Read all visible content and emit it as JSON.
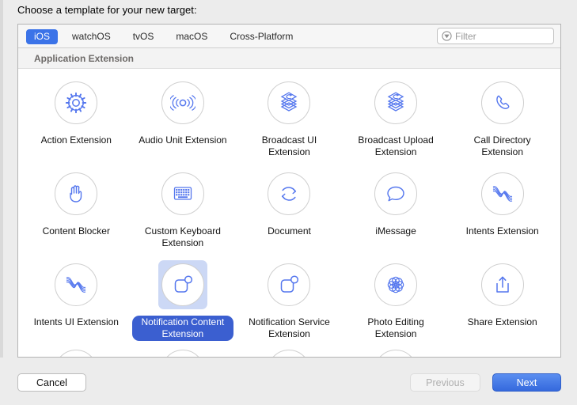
{
  "dialog": {
    "title": "Choose a template for your new target:"
  },
  "toolbar": {
    "tabs": [
      {
        "label": "iOS",
        "selected": true
      },
      {
        "label": "watchOS",
        "selected": false
      },
      {
        "label": "tvOS",
        "selected": false
      },
      {
        "label": "macOS",
        "selected": false
      },
      {
        "label": "Cross-Platform",
        "selected": false
      }
    ],
    "filter": {
      "placeholder": "Filter",
      "value": "",
      "icon": "filter-icon"
    },
    "selected_tab_color": "#3b73e8"
  },
  "section": {
    "header": "Application Extension"
  },
  "templates": [
    {
      "label": "Action Extension",
      "icon": "gear-icon",
      "selected": false
    },
    {
      "label": "Audio Unit Extension",
      "icon": "audio-waves-icon",
      "selected": false
    },
    {
      "label": "Broadcast UI Extension",
      "icon": "broadcast-layers-icon",
      "selected": false
    },
    {
      "label": "Broadcast Upload Extension",
      "icon": "broadcast-layers-icon",
      "selected": false
    },
    {
      "label": "Call Directory Extension",
      "icon": "phone-icon",
      "selected": false
    },
    {
      "label": "Content Blocker",
      "icon": "hand-icon",
      "selected": false
    },
    {
      "label": "Custom Keyboard Extension",
      "icon": "keyboard-icon",
      "selected": false
    },
    {
      "label": "Document",
      "icon": "refresh-circle-icon",
      "selected": false
    },
    {
      "label": "iMessage",
      "icon": "speech-bubble-icon",
      "selected": false
    },
    {
      "label": "Intents Extension",
      "icon": "crossing-waves-icon",
      "selected": false
    },
    {
      "label": "Intents UI Extension",
      "icon": "crossing-waves-icon",
      "selected": false
    },
    {
      "label": "Notification Content Extension",
      "icon": "notification-badge-icon",
      "selected": true
    },
    {
      "label": "Notification Service Extension",
      "icon": "notification-badge-icon",
      "selected": false
    },
    {
      "label": "Photo Editing Extension",
      "icon": "rosette-icon",
      "selected": false
    },
    {
      "label": "Share Extension",
      "icon": "share-upload-icon",
      "selected": false
    }
  ],
  "partial_row": [
    {
      "label": "",
      "icon": "clipped-icon"
    },
    {
      "label": "",
      "icon": "clipped-icon"
    },
    {
      "label": "",
      "icon": "clipped-icon"
    },
    {
      "label": "",
      "icon": "clipped-icon"
    }
  ],
  "footer": {
    "cancel_label": "Cancel",
    "previous_label": "Previous",
    "next_label": "Next",
    "next_color": "#3569dd"
  }
}
